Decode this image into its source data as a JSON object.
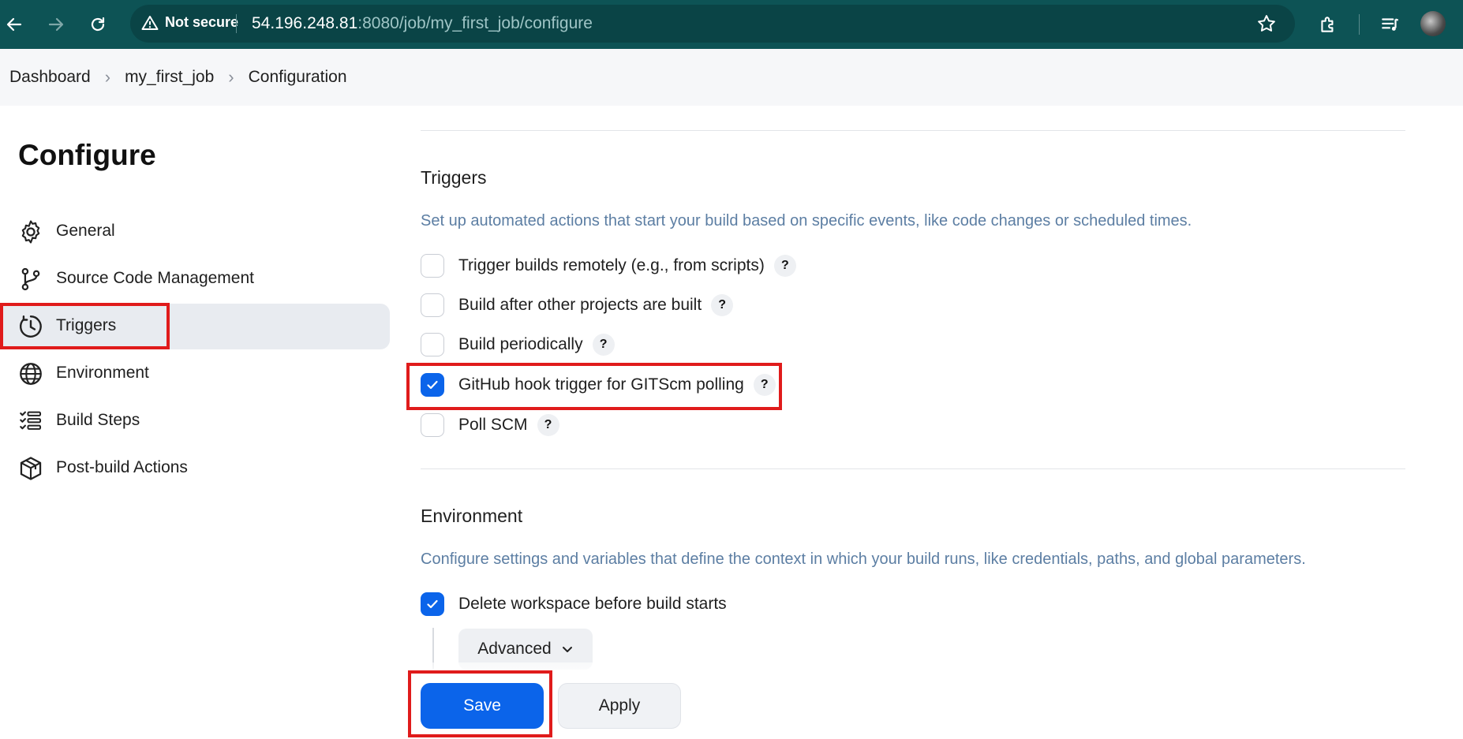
{
  "browser": {
    "security_label": "Not secure",
    "url_host": "54.196.248.81",
    "url_rest": ":8080/job/my_first_job/configure"
  },
  "breadcrumb": [
    "Dashboard",
    "my_first_job",
    "Configuration"
  ],
  "sidebar": {
    "title": "Configure",
    "items": [
      {
        "label": "General",
        "icon": "gear-icon"
      },
      {
        "label": "Source Code Management",
        "icon": "git-branch-icon"
      },
      {
        "label": "Triggers",
        "icon": "clock-icon",
        "active": true
      },
      {
        "label": "Environment",
        "icon": "globe-icon"
      },
      {
        "label": "Build Steps",
        "icon": "list-icon"
      },
      {
        "label": "Post-build Actions",
        "icon": "package-icon"
      }
    ]
  },
  "triggers": {
    "heading": "Triggers",
    "description": "Set up automated actions that start your build based on specific events, like code changes or scheduled times.",
    "options": [
      {
        "label": "Trigger builds remotely (e.g., from scripts)",
        "checked": false
      },
      {
        "label": "Build after other projects are built",
        "checked": false
      },
      {
        "label": "Build periodically",
        "checked": false
      },
      {
        "label": "GitHub hook trigger for GITScm polling",
        "checked": true
      },
      {
        "label": "Poll SCM",
        "checked": false
      }
    ],
    "help": "?"
  },
  "environment": {
    "heading": "Environment",
    "description": "Configure settings and variables that define the context in which your build runs, like credentials, paths, and global parameters.",
    "options": [
      {
        "label": "Delete workspace before build starts",
        "checked": true
      }
    ],
    "advanced_label": "Advanced"
  },
  "actions": {
    "save": "Save",
    "apply": "Apply"
  },
  "colors": {
    "accent": "#0b64ea",
    "topbar": "#0d5355",
    "highlight": "#e01b1b"
  }
}
